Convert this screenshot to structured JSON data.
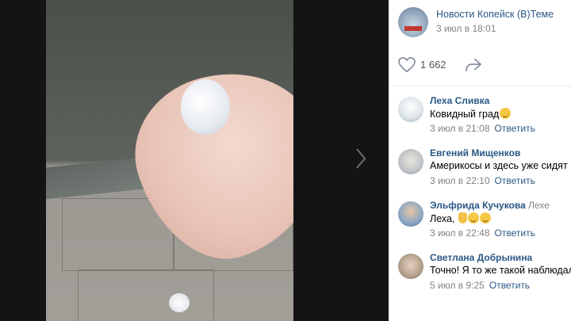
{
  "post": {
    "group_name": "Новости Копейск (В)Теме",
    "date": "3 июл в 18:01",
    "likes": "1 662"
  },
  "comments": [
    {
      "author": "Леха Сливка",
      "reply_to": "",
      "text": "Ковидный град",
      "emojis": [
        "grin-emoji"
      ],
      "date": "3 июл в 21:08",
      "reply_label": "Ответить"
    },
    {
      "author": "Евгений Мищенков",
      "reply_to": "",
      "text": "Америкосы и здесь уже сидят",
      "emojis": [],
      "date": "3 июл в 22:10",
      "reply_label": "Ответить"
    },
    {
      "author": "Эльфрида Кучукова",
      "reply_to": "Лехе",
      "text": "Леха,",
      "emojis": [
        "thumbs-up-emoji",
        "laughing-emoji",
        "laughing-emoji"
      ],
      "date": "3 июл в 22:48",
      "reply_label": "Ответить"
    },
    {
      "author": "Светлана Добрынина",
      "reply_to": "",
      "text": "Точно! Я то же такой наблюдала",
      "emojis": [],
      "date": "5 июл в 9:25",
      "reply_label": "Ответить"
    }
  ],
  "icons": {
    "like": "heart-icon",
    "share": "share-arrow-icon",
    "next": "chevron-right-icon"
  },
  "colors": {
    "link": "#2a5885",
    "meta": "#828282",
    "viewer_bg": "#141414"
  }
}
